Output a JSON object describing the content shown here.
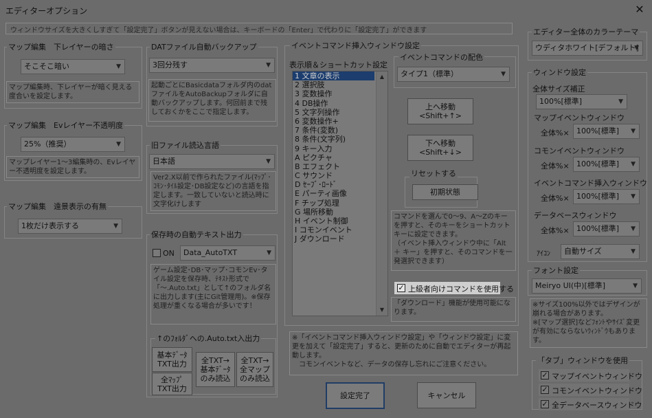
{
  "window": {
    "title": "エディターオプション",
    "close_label": "✕"
  },
  "hint": "ウィンドウサイズを大きくしすぎて「設定完了」ボタンが見えない場合は、キーボードの「Enter」で代わりに「設定完了」ができます",
  "map_layer_dark": {
    "label": "マップ編集　下レイヤーの暗さ",
    "value": "そこそこ暗い",
    "desc": "マップ編集時、下レイヤーが暗く見える度合いを設定します。"
  },
  "ev_layer_opacity": {
    "label": "マップ編集　Evレイヤー不透明度",
    "value": "25%（推奨）",
    "desc": "マップレイヤー1～3編集時の、Evレイヤー不透明度を設定します。"
  },
  "distant_view": {
    "label": "マップ編集　遠景表示の有無",
    "value": "1枚だけ表示する"
  },
  "dat_backup": {
    "label": "DATファイル自動バックアップ",
    "value": "3回分残す",
    "desc": "起動ごとにBasicdataフォルダ内のdatファイルをAutoBackupフォルダに自動バックアップします。何回前まで残しておくかをここで指定します。"
  },
  "old_file_lang": {
    "label": "旧ファイル読込言語",
    "value": "日本語",
    "desc": "Ver2.X以前で作られたファイル(ﾏｯﾌﾟ･ｺﾓﾝ･ﾀｲﾙ設定･DB設定など)の言語を指定します。一致していないと読込時に文字化けします"
  },
  "auto_text": {
    "label": "保存時の自動テキスト出力",
    "on_label": "ON",
    "checked": false,
    "value": "Data_AutoTXT",
    "desc": "ゲーム設定･DB･マップ･コモンEv･タイル設定を保存時、ﾃｷｽﾄ形式で「～.Auto.txt」として↑のフォルダ名に出力します(主にGit管理用)。※保存処理が重くなる場合が多いです！",
    "output_label": "↑のﾌｫﾙﾀﾞへの.Auto.txt入出力",
    "buttons": [
      "基本ﾃﾞｰﾀ\nTXT出力",
      "全TXT→\n基本ﾃﾞｰﾀ\nのみ読込",
      "全TXT→\n全マップ\nのみ読込",
      "全ﾏｯﾌﾟ\nTXT出力"
    ]
  },
  "event_cmd_window": {
    "label": "イベントコマンド挿入ウィンドウ設定",
    "order_label": "表示順＆ショートカット設定",
    "items": [
      "1 文章の表示",
      "2 選択肢",
      "3 変数操作",
      "4 DB操作",
      "5 文字列操作",
      "6 変数操作+",
      "7 条件(変数)",
      "8 条件(文字列)",
      "9 キー入力",
      "A ピクチャ",
      "B エフェクト",
      "C サウンド",
      "D ｾｰﾌﾞ･ﾛｰﾄﾞ",
      "E パーティ画像",
      "F チップ処理",
      "G 場所移動",
      "H イベント制御",
      "I コモンイベント",
      "J ダウンロード"
    ],
    "selected_index": 0,
    "color_label": "イベントコマンドの配色",
    "color_value": "タイプ1（標準）",
    "move_up": "上へ移動\n<Shift+↑>",
    "move_down": "下へ移動\n<Shift+↓>",
    "reset_label": "リセットする",
    "reset_button": "初期状態",
    "shortcut_desc": "コマンドを選んで0～9、A～Zのキーを押すと、そのキーをショートカットキーに設定できます。\n（イベント挿入ウィンドウ中に「Alt ＋ キー」を押すと、そのコマンドを一発選択できます）",
    "advanced_label": "上級者向けコマンドを使用する",
    "advanced_checked": true,
    "advanced_desc": "「ダウンロード」機能が使用可能になります。"
  },
  "notice": "※「イベントコマンド挿入ウィンドウ設定」や「ウィンドウ設定」に変更を加えて「設定完了」すると、更新のために自動でエディターが再起動します。\n　コモンイベントなど、データの保存し忘れにご注意ください。",
  "ok_button": "設定完了",
  "cancel_button": "キャンセル",
  "theme": {
    "label": "エディター全体のカラーテーマ",
    "value": "ウディタホワイト[デフォルト]"
  },
  "window_settings": {
    "label": "ウィンドウ設定",
    "overall_label": "全体サイズ補正",
    "overall_value": "100%[標準]",
    "rows": [
      {
        "label": "マップイベントウィンドウ",
        "prefix": "全体%×",
        "value": "100%[標準]"
      },
      {
        "label": "コモンイベントウィンドウ",
        "prefix": "全体%×",
        "value": "100%[標準]"
      },
      {
        "label": "イベントコマンド挿入ウィンドウ",
        "prefix": "全体%×",
        "value": "100%[標準]"
      },
      {
        "label": "データベースウィンドウ",
        "prefix": "全体%×",
        "value": "100%[標準]"
      }
    ],
    "icon_label": "ｱｲｺﾝ",
    "icon_value": "自動サイズ"
  },
  "font": {
    "label": "フォント設定",
    "value": "Meiryo UI(中)[標準]",
    "desc": "※サイズ100%以外ではデザインが崩れる場合があります。\n※[マップ選択]などﾌｫﾝﾄやｻｲｽﾞ変更が有効にならないｳｨﾝﾄﾞｳもあります。"
  },
  "tab_windows": {
    "label": "「タブ」ウィンドウを使用",
    "items": [
      {
        "label": "マップイベントウィンドウ",
        "checked": true
      },
      {
        "label": "コモンイベントウィンドウ",
        "checked": true
      },
      {
        "label": "全データベースウィンドウ",
        "checked": true
      }
    ]
  },
  "glyphs": {
    "check": "✓",
    "dropdown": "▼",
    "scroll_up": "▲",
    "scroll_down": "▼"
  }
}
